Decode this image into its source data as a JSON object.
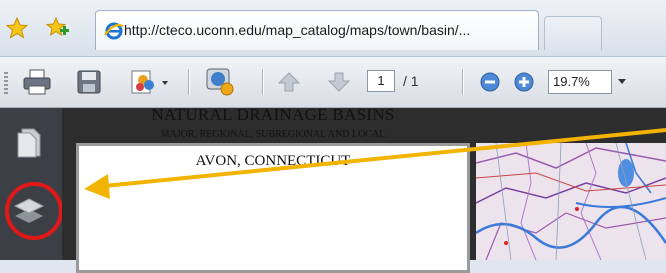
{
  "browser": {
    "active_tab": {
      "url": "http://cteco.uconn.edu/map_catalog/maps/town/basin/..."
    },
    "icons": {
      "favorites": "star-icon",
      "add_favorite": "add-favorite-icon",
      "page": "internet-explorer-icon"
    }
  },
  "toolbar": {
    "page_current": "1",
    "page_total": "/ 1",
    "zoom": "19.7%",
    "icons": [
      "print-icon",
      "save-icon",
      "share-icon",
      "collaborate-icon",
      "previous-page-icon",
      "next-page-icon",
      "zoom-out-icon",
      "zoom-in-icon"
    ]
  },
  "sidebar": {
    "icons": [
      "page-thumbnails-icon",
      "layers-icon"
    ],
    "highlight_color": "#e01818"
  },
  "document": {
    "title": "NATURAL DRAINAGE BASINS",
    "subtitle": "MAJOR, REGIONAL, SUBREGIONAL AND LOCAL",
    "town": "AVON, CONNECTICUT"
  },
  "annotation": {
    "arrow_color": "#f2b400"
  }
}
